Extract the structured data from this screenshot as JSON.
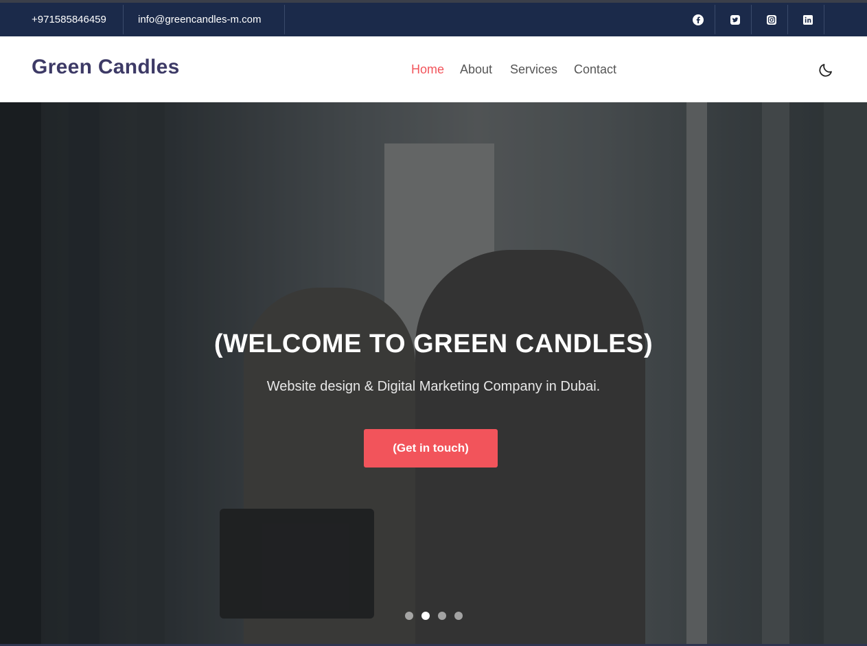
{
  "topbar": {
    "phone": "+971585846459",
    "email": "info@greencandles-m.com",
    "social": [
      {
        "icon": "facebook-icon"
      },
      {
        "icon": "twitter-icon"
      },
      {
        "icon": "instagram-icon"
      },
      {
        "icon": "linkedin-icon"
      }
    ]
  },
  "header": {
    "logo": "Green Candles",
    "nav": [
      {
        "label": "Home",
        "active": true
      },
      {
        "label": "About",
        "active": false
      },
      {
        "label": "Services",
        "active": false
      },
      {
        "label": "Contact",
        "active": false
      }
    ],
    "theme_toggle_icon": "moon-icon"
  },
  "hero": {
    "title": "(WELCOME TO GREEN CANDLES)",
    "subtitle": "Website design & Digital Marketing Company in Dubai.",
    "cta_label": "(Get in touch)",
    "slides_total": 4,
    "active_slide": 2
  },
  "colors": {
    "topbar_bg": "#1b2a4a",
    "accent": "#f2545b",
    "logo": "#3d3a66"
  }
}
